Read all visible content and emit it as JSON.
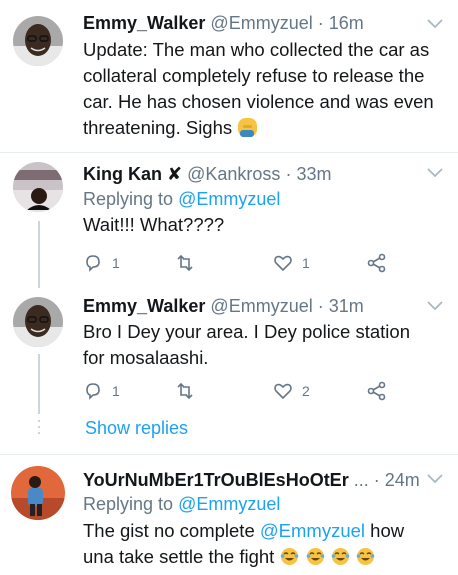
{
  "tweets": [
    {
      "name": "Emmy_Walker",
      "handle": "@Emmyzuel",
      "time": "16m",
      "text": "Update: The man who collected the car as collateral completely refuse to release the car. He has chosen violence and was even threatening. Sighs",
      "emoji": "person-facepalming"
    },
    {
      "name": "King Kan",
      "name_suffix": "✘",
      "handle": "@Kankross",
      "time": "33m",
      "replying_label": "Replying to",
      "replying_to": "@Emmyzuel",
      "text": "Wait!!! What????",
      "replies": "1",
      "retweets": "",
      "likes": "1"
    },
    {
      "name": "Emmy_Walker",
      "handle": "@Emmyzuel",
      "time": "31m",
      "text_line1": "Bro I Dey your area. I Dey police station",
      "text_line2": "for mosalaashi.",
      "replies": "1",
      "retweets": "",
      "likes": "2",
      "show_replies": "Show replies"
    },
    {
      "name": "YoUrNuMbEr1TrOuBlEsHoOtEr",
      "name_ellipsis": "...",
      "time": "24m",
      "replying_label": "Replying to",
      "replying_to": "@Emmyzuel",
      "text_before": "The gist no complete",
      "mention": "@Emmyzuel",
      "text_after": "how",
      "text_line2": "una take settle the fight",
      "emoji": "face-with-tears-of-joy"
    }
  ],
  "colors": {
    "link": "#1da1f2",
    "secondary": "#657786",
    "divider": "#e6ecf0"
  },
  "icons": [
    "reply-icon",
    "retweet-icon",
    "like-icon",
    "share-icon",
    "chevron-down-icon"
  ]
}
